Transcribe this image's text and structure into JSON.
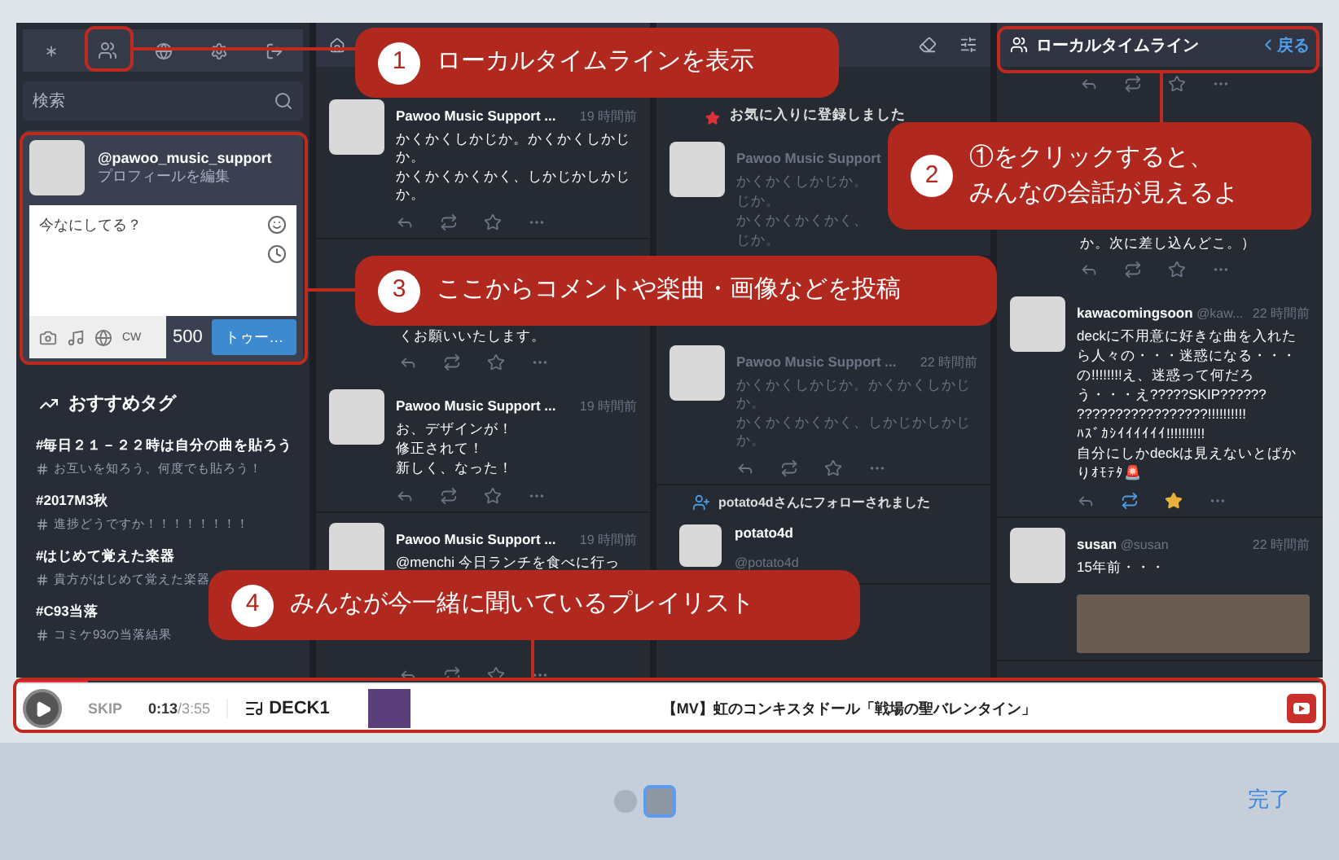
{
  "sidebar": {
    "search": {
      "placeholder": "検索"
    },
    "profile": {
      "handle": "@pawoo_music_support",
      "edit_link": "プロフィールを編集"
    },
    "compose": {
      "placeholder": "今なにしてる？",
      "cw": "CW",
      "counter": "500",
      "submit": "トゥー…"
    },
    "trending": {
      "title": "おすすめタグ",
      "tags": [
        {
          "tag": "#毎日２１－２２時は自分の曲を貼ろう",
          "description": "お互いを知ろう、何度でも貼ろう！"
        },
        {
          "tag": "#2017M3秋",
          "description": "進捗どうですか！！！！！！！！"
        },
        {
          "tag": "#はじめて覚えた楽器",
          "description": "貴方がはじめて覚えた楽器"
        },
        {
          "tag": "#C93当落",
          "description": "コミケ93の当落結果"
        }
      ]
    }
  },
  "home_column": {
    "items": [
      {
        "kind": "post",
        "name": "Pawoo Music Support ...",
        "time": "19 時間前",
        "lines": [
          "かくかくしかじか。かくかくしかじか。",
          "かくかくかくかく、しかじかしかじか。"
        ],
        "dimmed": false,
        "boosted": false,
        "favourited": false
      },
      {
        "kind": "text",
        "text": "くお願いいたします。"
      },
      {
        "kind": "actions",
        "boosted": false,
        "favourited": false
      },
      {
        "kind": "post",
        "name": "Pawoo Music Support ...",
        "time": "19 時間前",
        "lines": [
          "お、デザインが！",
          "修正されて！",
          "新しく、なった！"
        ],
        "dimmed": false,
        "boosted": false,
        "favourited": false
      },
      {
        "kind": "post",
        "name": "Pawoo Music Support ...",
        "time": "19 時間前",
        "lines": [
          "@menchi 今日ランチを食べに行っ"
        ],
        "dimmed": false
      },
      {
        "kind": "actions",
        "boosted": false,
        "favourited": false
      }
    ]
  },
  "notifications_column": {
    "items": [
      {
        "kind": "notice",
        "text": "お気に入りに登録しました"
      },
      {
        "kind": "post",
        "name": "Pawoo Music Support",
        "lines": [
          "かくかくしかじか。",
          "じか。",
          "かくかくかくかく、",
          "じか。"
        ],
        "dimmed": true
      },
      {
        "kind": "post",
        "name": "Pawoo Music Support ...",
        "time": "22 時間前",
        "lines": [
          "かくかくしかじか。かくかくしかじか。",
          "かくかくかくかく、しかじかしかじか。"
        ],
        "dimmed": true,
        "boosted": false,
        "favourited": false
      },
      {
        "kind": "follow",
        "text": "potato4dさんにフォローされました",
        "name": "potato4d",
        "handle": "@potato4d"
      }
    ]
  },
  "local_column": {
    "title": "ローカルタイムライン",
    "back": "戻る",
    "items": [
      {
        "kind": "actions",
        "boosted": false,
        "favourited": false
      },
      {
        "kind": "text",
        "text": "か。次に差し込んどこ。）"
      },
      {
        "kind": "actions",
        "boosted": false,
        "favourited": false
      },
      {
        "kind": "post",
        "name": "kawacomingsoon",
        "handle": "@kaw...",
        "time": "22 時間前",
        "lines": [
          "deckに不用意に好きな曲を入れた",
          "ら人々の・・・迷惑になる・・・",
          "の!!!!!!!!え、迷惑って何だろ",
          "う・・・え?????SKIP??????",
          "?????????????????!!!!!!!!!!",
          "ﾊｽﾞｶｼｲｲｲｲｲｲ!!!!!!!!!!",
          "自分にしかdeckは見えないとばか",
          "りｵﾓﾃﾀ🚨"
        ],
        "dimmed": false,
        "boosted": true,
        "favourited": true
      },
      {
        "kind": "post",
        "name": "susan",
        "handle": "@susan",
        "time": "22 時間前",
        "lines": [
          "15年前・・・"
        ],
        "dimmed": false,
        "image": true
      }
    ]
  },
  "player": {
    "skip": "SKIP",
    "elapsed": "0:13",
    "duration": "/3:55",
    "deck": "DECK1",
    "title": "【MV】虹のコンキスタドール「戦場の聖バレンタイン」",
    "level": 0.055
  },
  "callouts": [
    {
      "number": "1",
      "lines": [
        "ローカルタイムラインを表示"
      ]
    },
    {
      "number": "2",
      "lines": [
        "①をクリックすると、",
        "みんなの会話が見えるよ"
      ]
    },
    {
      "number": "3",
      "lines": [
        "ここからコメントや楽曲・画像などを投稿"
      ]
    },
    {
      "number": "4",
      "lines": [
        "みんなが今一緒に聞いているプレイリスト"
      ]
    }
  ],
  "pager": {
    "pages": [
      {
        "selected": false
      },
      {
        "selected": true
      }
    ],
    "done": "完了"
  }
}
